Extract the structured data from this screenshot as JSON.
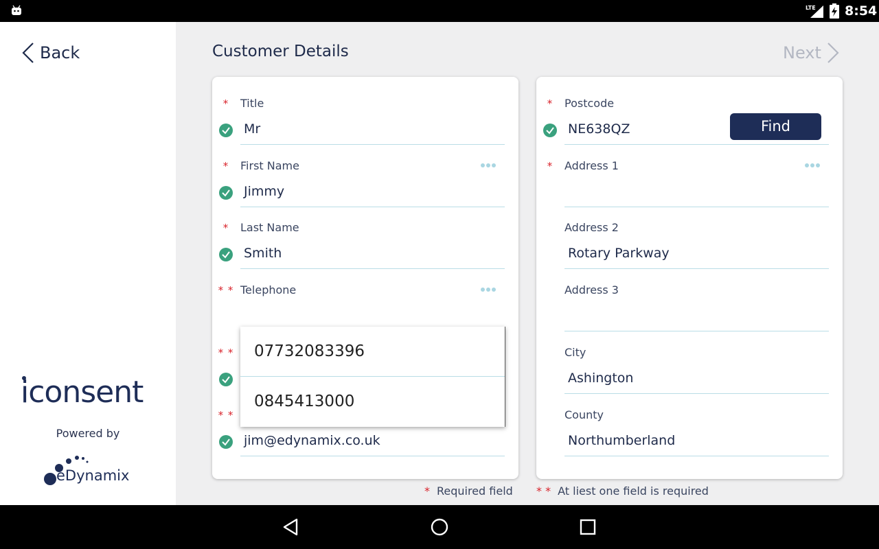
{
  "status_bar": {
    "time": "8:54",
    "network": "LTE"
  },
  "sidebar": {
    "back_label": "Back",
    "logo_text": "iconsent",
    "powered_by": "Powered by",
    "partner_logo_text": "eDynamix"
  },
  "header": {
    "title": "Customer Details",
    "next_label": "Next"
  },
  "left_card": {
    "fields": [
      {
        "label": "Title",
        "required": "*",
        "value": "Mr",
        "valid": true
      },
      {
        "label": "First Name",
        "required": "*",
        "value": "Jimmy",
        "valid": true,
        "has_more": true
      },
      {
        "label": "Last Name",
        "required": "*",
        "value": "Smith",
        "valid": true
      },
      {
        "label": "Telephone",
        "required": "* *",
        "value": "",
        "valid": false,
        "has_more": true
      },
      {
        "label": "",
        "required": "* *",
        "value": "",
        "valid": true
      },
      {
        "label": "",
        "required": "* *",
        "value": "jim@edynamix.co.uk",
        "valid": true
      }
    ]
  },
  "right_card": {
    "find_label": "Find",
    "fields": [
      {
        "label": "Postcode",
        "required": "*",
        "value": "NE638QZ",
        "valid": true
      },
      {
        "label": "Address 1",
        "required": "*",
        "value": "",
        "valid": false,
        "has_more": true
      },
      {
        "label": "Address 2",
        "required": "",
        "value": "Rotary Parkway",
        "valid": false
      },
      {
        "label": "Address 3",
        "required": "",
        "value": "",
        "valid": false
      },
      {
        "label": "City",
        "required": "",
        "value": "Ashington",
        "valid": false
      },
      {
        "label": "County",
        "required": "",
        "value": "Northumberland",
        "valid": false
      }
    ]
  },
  "telephone_dropdown": {
    "options": [
      "07732083396",
      "0845413000"
    ]
  },
  "legend": {
    "required_star": "*",
    "required_text": "Required field",
    "atleast_star": "* *",
    "atleast_text": "At liest one field is required"
  },
  "colors": {
    "accent": "#1e2d57",
    "valid": "#3aa17e",
    "required": "#d9242c",
    "underline": "#b9dde6"
  }
}
